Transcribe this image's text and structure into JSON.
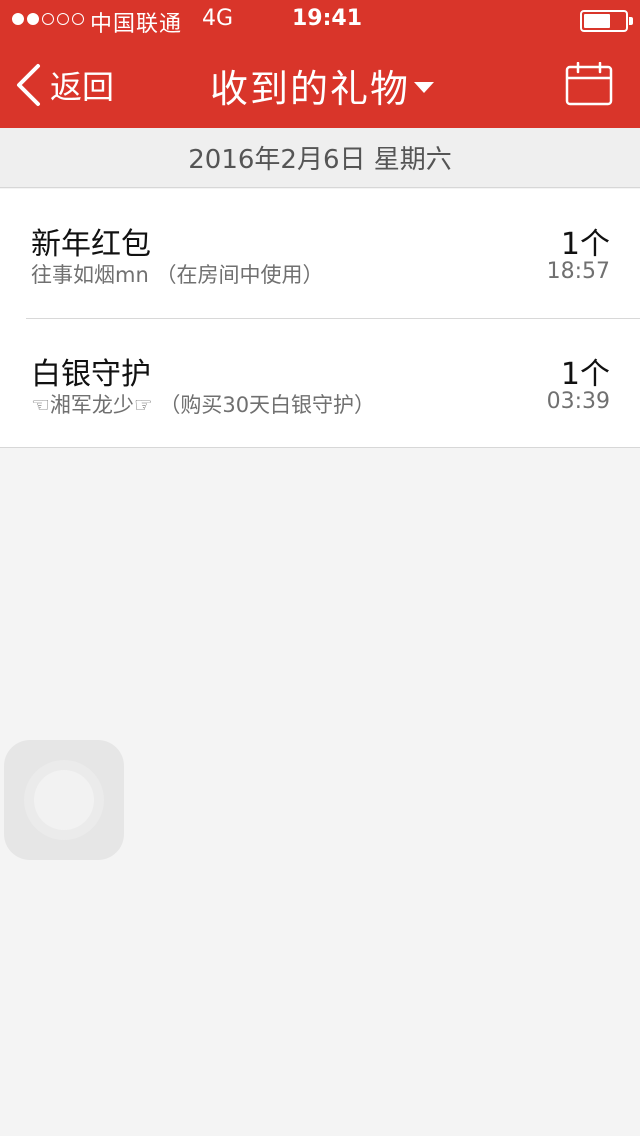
{
  "status_bar": {
    "carrier": "中国联通",
    "network": "4G",
    "time": "19:41",
    "signal_full": 2,
    "signal_total": 5,
    "battery_level": 0.55
  },
  "nav": {
    "back_label": "返回",
    "title": "收到的礼物",
    "icons": [
      "chevron-left-icon",
      "caret-down-icon",
      "calendar-icon"
    ]
  },
  "date_header": "2016年2月6日 星期六",
  "gifts": [
    {
      "name": "新年红包",
      "detail": "往事如烟mn （在房间中使用）",
      "count": "1个",
      "time": "18:57"
    },
    {
      "name": "白银守护",
      "detail": "☜湘军龙少☞ （购买30天白银守护）",
      "count": "1个",
      "time": "03:39"
    }
  ],
  "colors": {
    "accent": "#d9352a",
    "background": "#f4f4f4"
  }
}
